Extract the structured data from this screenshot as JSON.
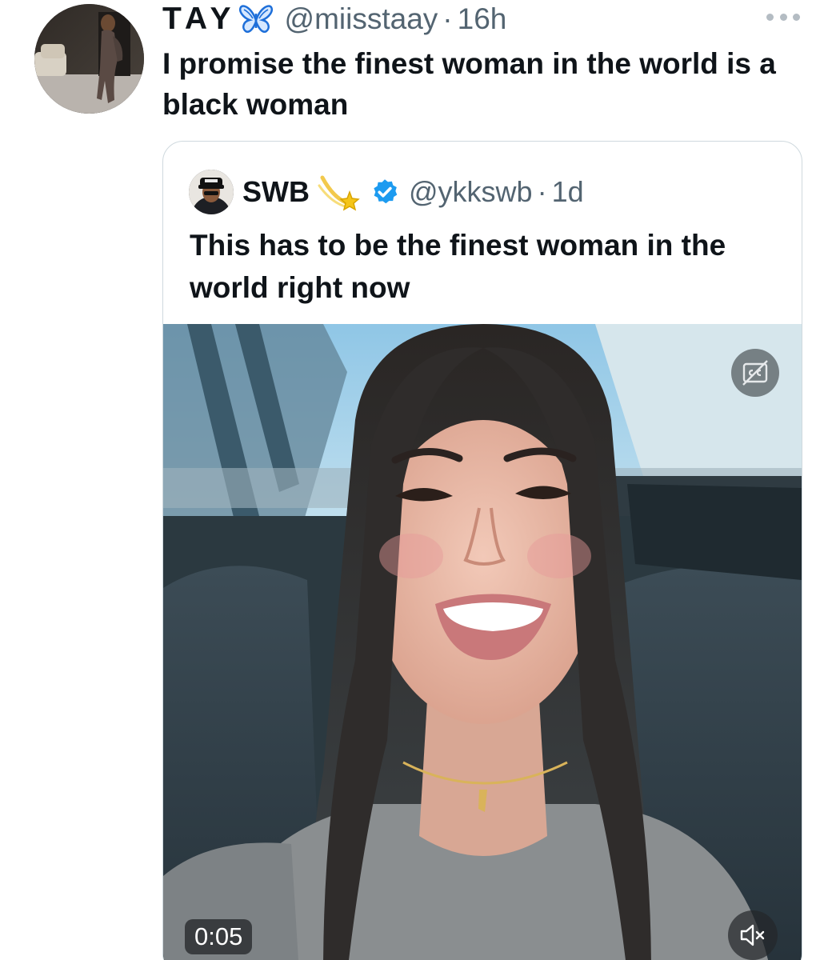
{
  "tweet": {
    "display_name": "TAY",
    "name_emoji_icon": "butterfly-icon",
    "handle": "@miisstaay",
    "separator": "·",
    "time": "16h",
    "text": "I promise the finest woman in the world is a black woman",
    "more_icon": "more-options-icon"
  },
  "quoted_tweet": {
    "display_name": "SWB",
    "name_emoji_icon": "shooting-star-icon",
    "verified_icon": "verified-badge-icon",
    "handle": "@ykkswb",
    "separator": "·",
    "time": "1d",
    "text": "This has to be the finest woman in the world right now",
    "video": {
      "duration": "0:05",
      "captions_icon": "captions-off-icon",
      "mute_icon": "muted-speaker-icon"
    }
  },
  "colors": {
    "text_primary": "#0f1419",
    "text_secondary": "#536471",
    "border": "#cfd9de",
    "verified_blue": "#1d9bf0",
    "butterfly_blue": "#1e6fd9"
  }
}
